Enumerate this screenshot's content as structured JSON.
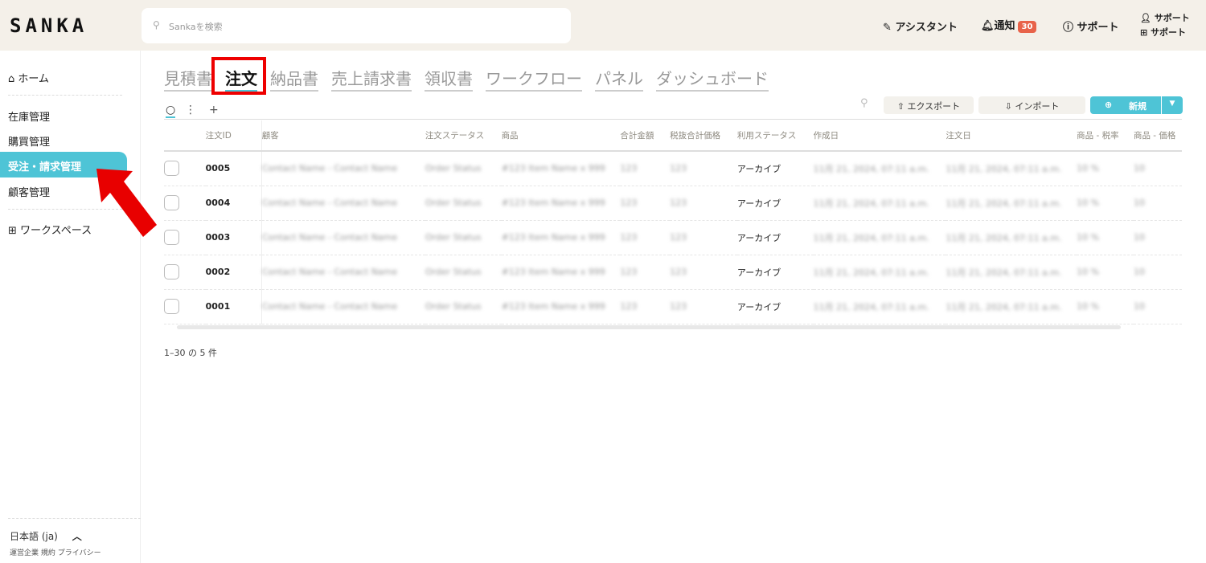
{
  "header": {
    "logo": "SANKA",
    "search_placeholder": "Sankaを検索",
    "assistant": "アシスタント",
    "notifications": "通知",
    "notification_count": "30",
    "support": "サポート",
    "user_line1": "サポート",
    "user_line2": "サポート"
  },
  "sidebar": {
    "home": "ホーム",
    "items": [
      "在庫管理",
      "購買管理",
      "受注・請求管理",
      "顧客管理"
    ],
    "active_index": 2,
    "workspace": "ワークスペース",
    "language": "日本語 (ja)",
    "footer_links": [
      "運営企業",
      "規約",
      "プライバシー"
    ]
  },
  "tabs": [
    "見積書",
    "注文",
    "納品書",
    "売上請求書",
    "領収書",
    "ワークフロー",
    "パネル",
    "ダッシュボード"
  ],
  "active_tab": "注文",
  "toolbar": {
    "add": "+",
    "export": "エクスポート",
    "import": "インポート",
    "new": "新規"
  },
  "table": {
    "columns": [
      "注文ID",
      "顧客",
      "注文ステータス",
      "商品",
      "合計金額",
      "税抜合計価格",
      "利用ステータス",
      "作成日",
      "注文日",
      "商品 - 税率",
      "商品 - 価格"
    ],
    "rows": [
      [
        "0005",
        "Contact Name - Contact Name",
        "Order Status",
        "#123 Item Name x 999",
        "123",
        "123",
        "アーカイブ",
        "11月 21, 2024, 07:11 a.m.",
        "11月 21, 2024, 07:11 a.m.",
        "10 %",
        "10"
      ],
      [
        "0004",
        "Contact Name - Contact Name",
        "Order Status",
        "#123 Item Name x 999",
        "123",
        "123",
        "アーカイブ",
        "11月 21, 2024, 07:11 a.m.",
        "11月 21, 2024, 07:11 a.m.",
        "10 %",
        "10"
      ],
      [
        "0003",
        "Contact Name - Contact Name",
        "Order Status",
        "#123 Item Name x 999",
        "123",
        "123",
        "アーカイブ",
        "11月 21, 2024, 07:11 a.m.",
        "11月 21, 2024, 07:11 a.m.",
        "10 %",
        "10"
      ],
      [
        "0002",
        "Contact Name - Contact Name",
        "Order Status",
        "#123 Item Name x 999",
        "123",
        "123",
        "アーカイブ",
        "11月 21, 2024, 07:11 a.m.",
        "11月 21, 2024, 07:11 a.m.",
        "10 %",
        "10"
      ],
      [
        "0001",
        "Contact Name - Contact Name",
        "Order Status",
        "#123 Item Name x 999",
        "123",
        "123",
        "アーカイブ",
        "11月 21, 2024, 07:11 a.m.",
        "11月 21, 2024, 07:11 a.m.",
        "10 %",
        "10"
      ]
    ]
  },
  "pagination": "1–30 の 5 件",
  "colors": {
    "accent": "#4ec4d6",
    "badge": "#e8634a",
    "highlight": "#ee0000"
  }
}
